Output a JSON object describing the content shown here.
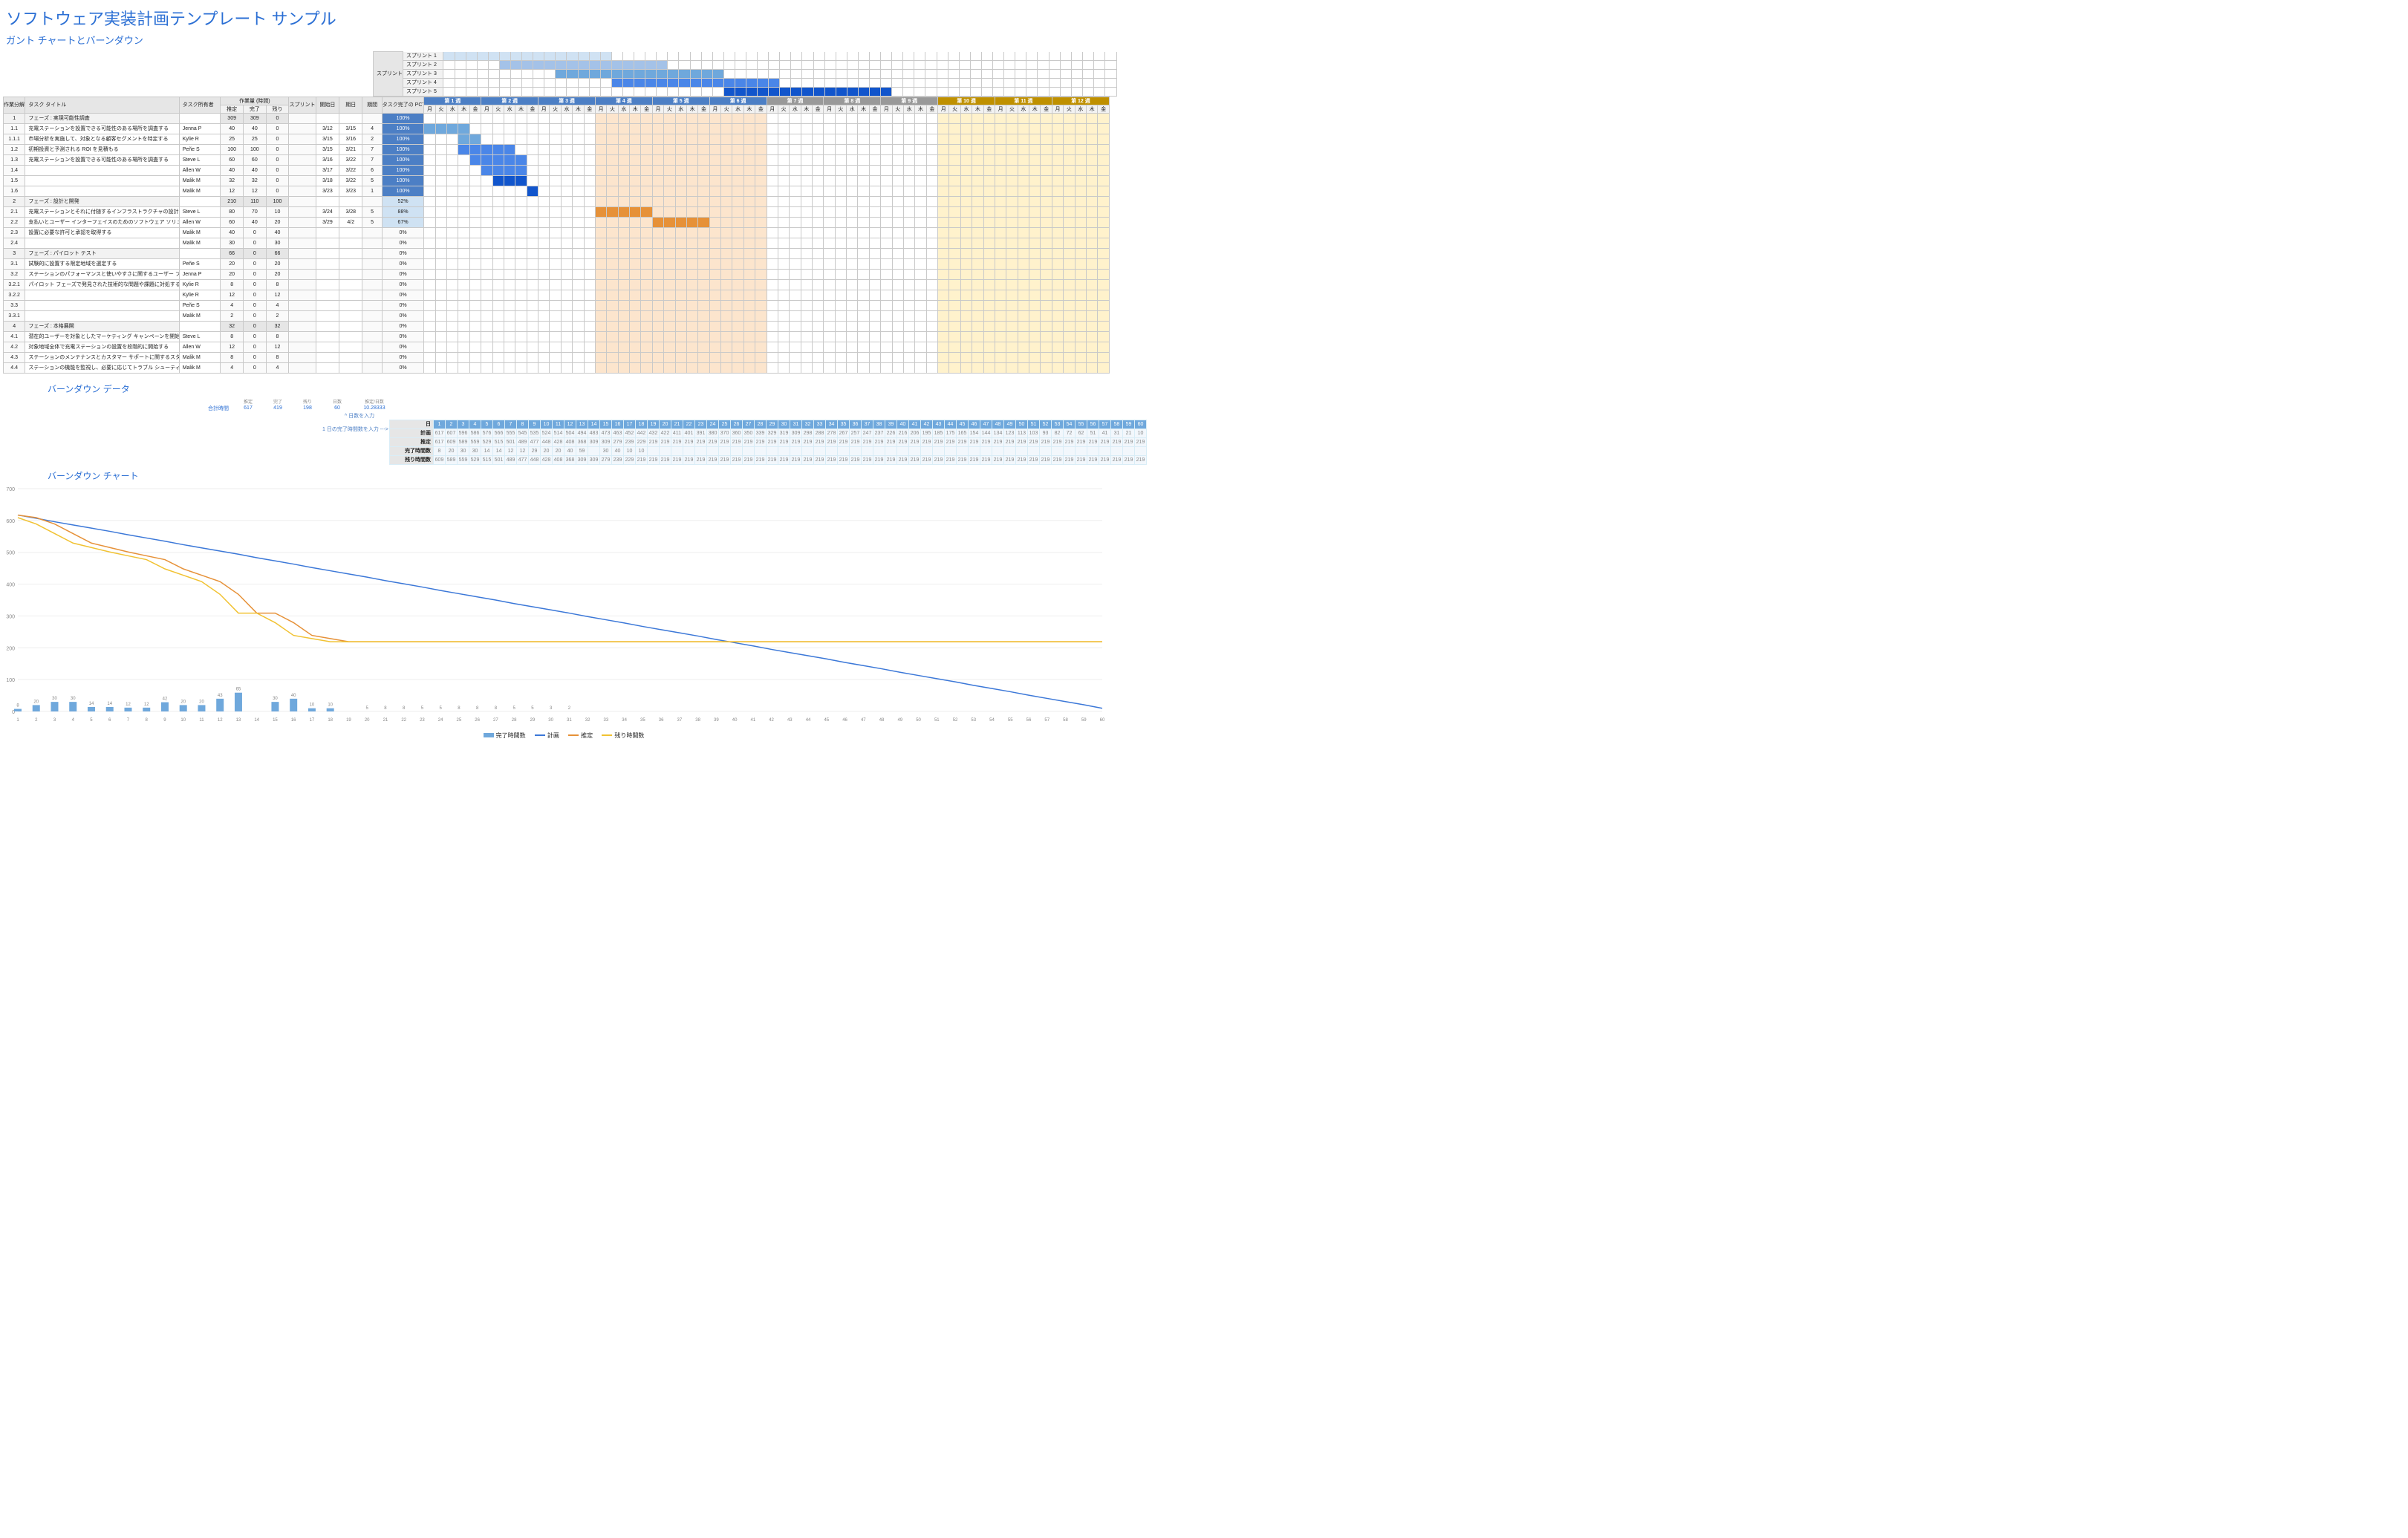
{
  "title": "ソフトウェア実装計画テンプレート サンプル",
  "subtitle": "ガント チャートとバーンダウン",
  "sprint_label": "スプリント",
  "sprints": [
    "スプリント 1",
    "スプリント 2",
    "スプリント 3",
    "スプリント 4",
    "スプリント 5"
  ],
  "cols": {
    "wbs": "作業分解構成",
    "title": "タスク タイトル",
    "owner": "タスク所有者",
    "workload": "作業量 (時間)",
    "est": "推定",
    "done": "完了",
    "rem": "残り",
    "sprint": "スプリント",
    "start": "開始日",
    "end": "期日",
    "dur": "期間",
    "pct": "タスク完了の PCT"
  },
  "weeks": [
    {
      "label": "第 1 週",
      "cls": "blueH"
    },
    {
      "label": "第 2 週",
      "cls": "blueH"
    },
    {
      "label": "第 3 週",
      "cls": "blueH"
    },
    {
      "label": "第 4 週",
      "cls": "blueH"
    },
    {
      "label": "第 5 週",
      "cls": "blueH"
    },
    {
      "label": "第 6 週",
      "cls": "blueH"
    },
    {
      "label": "第 7 週",
      "cls": "grayH"
    },
    {
      "label": "第 8 週",
      "cls": "grayH"
    },
    {
      "label": "第 9 週",
      "cls": "grayH"
    },
    {
      "label": "第 10 週",
      "cls": "goldH"
    },
    {
      "label": "第 11 週",
      "cls": "goldH"
    },
    {
      "label": "第 12 週",
      "cls": "goldH"
    }
  ],
  "days": [
    "月",
    "火",
    "水",
    "木",
    "金"
  ],
  "rows": [
    {
      "n": "1",
      "t": "フェーズ : 実現可能性調査",
      "o": "",
      "e": "309",
      "d": "309",
      "r": "0",
      "sp": "",
      "s": "",
      "en": "",
      "du": "",
      "p": "100%",
      "pc": "pct100",
      "phase": 1,
      "bar": null
    },
    {
      "n": "1.1",
      "t": "充電ステーションを設置できる可能性のある場所を調査する",
      "o": "Jenna P",
      "e": "40",
      "d": "40",
      "r": "0",
      "sp": "",
      "s": "3/12",
      "en": "3/15",
      "du": "4",
      "p": "100%",
      "pc": "pct100",
      "bar": [
        0,
        4,
        "bfill1"
      ]
    },
    {
      "n": "1.1.1",
      "t": "市場分析を実施して、対象となる顧客セグメントを特定する",
      "o": "Kylie R",
      "e": "25",
      "d": "25",
      "r": "0",
      "sp": "",
      "s": "3/15",
      "en": "3/16",
      "du": "2",
      "p": "100%",
      "pc": "pct100",
      "bar": [
        3,
        2,
        "bfill1"
      ]
    },
    {
      "n": "1.2",
      "t": "初期投資と予測される ROI を見積もる",
      "o": "Peñe S",
      "e": "100",
      "d": "100",
      "r": "0",
      "sp": "",
      "s": "3/15",
      "en": "3/21",
      "du": "7",
      "p": "100%",
      "pc": "pct100",
      "bar": [
        3,
        5,
        "bfill2"
      ]
    },
    {
      "n": "1.3",
      "t": "充電ステーションを設置できる可能性のある場所を調査する",
      "o": "Steve L",
      "e": "60",
      "d": "60",
      "r": "0",
      "sp": "",
      "s": "3/16",
      "en": "3/22",
      "du": "7",
      "p": "100%",
      "pc": "pct100",
      "bar": [
        4,
        5,
        "bfill2"
      ]
    },
    {
      "n": "1.4",
      "t": "",
      "o": "Allen W",
      "e": "40",
      "d": "40",
      "r": "0",
      "sp": "",
      "s": "3/17",
      "en": "3/22",
      "du": "6",
      "p": "100%",
      "pc": "pct100",
      "bar": [
        5,
        4,
        "bfill2"
      ]
    },
    {
      "n": "1.5",
      "t": "",
      "o": "Malik M",
      "e": "32",
      "d": "32",
      "r": "0",
      "sp": "",
      "s": "3/18",
      "en": "3/22",
      "du": "5",
      "p": "100%",
      "pc": "pct100",
      "bar": [
        6,
        3,
        "bfill3"
      ]
    },
    {
      "n": "1.6",
      "t": "",
      "o": "Malik M",
      "e": "12",
      "d": "12",
      "r": "0",
      "sp": "",
      "s": "3/23",
      "en": "3/23",
      "du": "1",
      "p": "100%",
      "pc": "pct100",
      "bar": [
        9,
        1,
        "bfill3"
      ]
    },
    {
      "n": "2",
      "t": "フェーズ : 設計と開発",
      "o": "",
      "e": "210",
      "d": "110",
      "r": "100",
      "sp": "",
      "s": "",
      "en": "",
      "du": "",
      "p": "52%",
      "pc": "pct",
      "phase": 1,
      "bar": null
    },
    {
      "n": "2.1",
      "t": "充電ステーションとそれに付随するインフラストラクチャの設計を確定する",
      "o": "Steve L",
      "e": "80",
      "d": "70",
      "r": "10",
      "sp": "",
      "s": "3/24",
      "en": "3/28",
      "du": "5",
      "p": "88%",
      "pc": "pct",
      "bar": [
        15,
        5,
        "of"
      ]
    },
    {
      "n": "2.2",
      "t": "支払いとユーザー インターフェイスのためのソフトウェア ソリューションを開発する",
      "o": "Allen W",
      "e": "60",
      "d": "40",
      "r": "20",
      "sp": "",
      "s": "3/29",
      "en": "4/2",
      "du": "5",
      "p": "67%",
      "pc": "pct",
      "bar": [
        20,
        5,
        "of"
      ]
    },
    {
      "n": "2.3",
      "t": "設置に必要な許可と承認を取得する",
      "o": "Malik M",
      "e": "40",
      "d": "0",
      "r": "40",
      "sp": "",
      "s": "",
      "en": "",
      "du": "",
      "p": "0%",
      "pc": "",
      "bar": null
    },
    {
      "n": "2.4",
      "t": "",
      "o": "Malik M",
      "e": "30",
      "d": "0",
      "r": "30",
      "sp": "",
      "s": "",
      "en": "",
      "du": "",
      "p": "0%",
      "pc": "",
      "bar": null
    },
    {
      "n": "3",
      "t": "フェーズ : パイロット テスト",
      "o": "",
      "e": "66",
      "d": "0",
      "r": "66",
      "sp": "",
      "s": "",
      "en": "",
      "du": "",
      "p": "0%",
      "pc": "",
      "phase": 1,
      "bar": null
    },
    {
      "n": "3.1",
      "t": "試験的に設置する限定地域を選定する",
      "o": "Peñe S",
      "e": "20",
      "d": "0",
      "r": "20",
      "sp": "",
      "s": "",
      "en": "",
      "du": "",
      "p": "0%",
      "pc": "",
      "bar": null
    },
    {
      "n": "3.2",
      "t": "ステーションのパフォーマンスと使いやすさに関するユーザー フィードバックを収集する",
      "o": "Jenna P",
      "e": "20",
      "d": "0",
      "r": "20",
      "sp": "",
      "s": "",
      "en": "",
      "du": "",
      "p": "0%",
      "pc": "",
      "bar": null
    },
    {
      "n": "3.2.1",
      "t": "パイロット フェーズで発見された技術的な問題や課題に対処する",
      "o": "Kylie R",
      "e": "8",
      "d": "0",
      "r": "8",
      "sp": "",
      "s": "",
      "en": "",
      "du": "",
      "p": "0%",
      "pc": "",
      "bar": null
    },
    {
      "n": "3.2.2",
      "t": "",
      "o": "Kylie R",
      "e": "12",
      "d": "0",
      "r": "12",
      "sp": "",
      "s": "",
      "en": "",
      "du": "",
      "p": "0%",
      "pc": "",
      "bar": null
    },
    {
      "n": "3.3",
      "t": "",
      "o": "Peñe S",
      "e": "4",
      "d": "0",
      "r": "4",
      "sp": "",
      "s": "",
      "en": "",
      "du": "",
      "p": "0%",
      "pc": "",
      "bar": null
    },
    {
      "n": "3.3.1",
      "t": "",
      "o": "Malik M",
      "e": "2",
      "d": "0",
      "r": "2",
      "sp": "",
      "s": "",
      "en": "",
      "du": "",
      "p": "0%",
      "pc": "",
      "bar": null
    },
    {
      "n": "4",
      "t": "フェーズ : 本格展開",
      "o": "",
      "e": "32",
      "d": "0",
      "r": "32",
      "sp": "",
      "s": "",
      "en": "",
      "du": "",
      "p": "0%",
      "pc": "",
      "phase": 1,
      "bar": null
    },
    {
      "n": "4.1",
      "t": "潜在的ユーザーを対象としたマーケティング キャンペーンを開始する",
      "o": "Steve L",
      "e": "8",
      "d": "0",
      "r": "8",
      "sp": "",
      "s": "",
      "en": "",
      "du": "",
      "p": "0%",
      "pc": "",
      "bar": null
    },
    {
      "n": "4.2",
      "t": "対象地域全体で充電ステーションの設置を段階的に開始する",
      "o": "Allen W",
      "e": "12",
      "d": "0",
      "r": "12",
      "sp": "",
      "s": "",
      "en": "",
      "du": "",
      "p": "0%",
      "pc": "",
      "bar": null
    },
    {
      "n": "4.3",
      "t": "ステーションのメンテナンスとカスタマー サポートに関するスタッフのトレーニングを行う",
      "o": "Malik M",
      "e": "8",
      "d": "0",
      "r": "8",
      "sp": "",
      "s": "",
      "en": "",
      "du": "",
      "p": "0%",
      "pc": "",
      "bar": null
    },
    {
      "n": "4.4",
      "t": "ステーションの機能を監視し、必要に応じてトラブル シューティングを行う",
      "o": "Malik M",
      "e": "4",
      "d": "0",
      "r": "4",
      "sp": "",
      "s": "",
      "en": "",
      "du": "",
      "p": "0%",
      "pc": "",
      "bar": null
    }
  ],
  "bd": {
    "title": "バーンダウン データ",
    "total_label": "合計時間",
    "est": "推定",
    "done": "完了",
    "rem": "残り",
    "days": "日数",
    "rate": "推定/日数",
    "total": "617",
    "d": "419",
    "r": "198",
    "dd": "60",
    "rr": "10.28333",
    "note1": "^ 日数を入力",
    "note2": "1 日の完了時間数を入力 --->",
    "rows": {
      "day": "日",
      "plan": "計画",
      "est": "推定",
      "done": "完了時間数",
      "rem": "残り時間数"
    }
  },
  "bd_data": {
    "plan": [
      "617",
      "607",
      "596",
      "586",
      "576",
      "566",
      "555",
      "545",
      "535",
      "524",
      "514",
      "504",
      "494",
      "483",
      "473",
      "463",
      "452",
      "442",
      "432",
      "422",
      "411",
      "401",
      "391",
      "380",
      "370",
      "360",
      "350",
      "339",
      "329",
      "319",
      "309",
      "298",
      "288",
      "278",
      "267",
      "257",
      "247",
      "237",
      "226",
      "216",
      "206",
      "195",
      "185",
      "175",
      "165",
      "154",
      "144",
      "134",
      "123",
      "113",
      "103",
      "93",
      "82",
      "72",
      "62",
      "51",
      "41",
      "31",
      "21",
      "10"
    ],
    "est": [
      "617",
      "609",
      "589",
      "559",
      "529",
      "515",
      "501",
      "489",
      "477",
      "448",
      "428",
      "408",
      "368",
      "309",
      "309",
      "279",
      "239",
      "229",
      "219",
      "219",
      "219",
      "219",
      "219",
      "219",
      "219",
      "219",
      "219",
      "219",
      "219",
      "219",
      "219",
      "219",
      "219",
      "219",
      "219",
      "219",
      "219",
      "219",
      "219",
      "219",
      "219",
      "219",
      "219",
      "219",
      "219",
      "219",
      "219",
      "219",
      "219",
      "219",
      "219",
      "219",
      "219",
      "219",
      "219",
      "219",
      "219",
      "219",
      "219",
      "219"
    ],
    "done": [
      "8",
      "20",
      "30",
      "30",
      "14",
      "14",
      "12",
      "12",
      "29",
      "20",
      "20",
      "40",
      "59",
      "",
      "30",
      "40",
      "10",
      "10",
      "",
      "",
      "",
      "",
      "",
      "",
      "",
      "",
      "",
      "",
      "",
      "",
      "",
      "",
      "",
      "",
      "",
      "",
      "",
      "",
      "",
      "",
      "",
      "",
      "",
      "",
      "",
      "",
      "",
      "",
      "",
      "",
      "",
      "",
      "",
      "",
      "",
      "",
      "",
      "",
      "",
      ""
    ],
    "rem": [
      "609",
      "589",
      "559",
      "529",
      "515",
      "501",
      "489",
      "477",
      "448",
      "428",
      "408",
      "368",
      "309",
      "309",
      "279",
      "239",
      "229",
      "219",
      "219",
      "219",
      "219",
      "219",
      "219",
      "219",
      "219",
      "219",
      "219",
      "219",
      "219",
      "219",
      "219",
      "219",
      "219",
      "219",
      "219",
      "219",
      "219",
      "219",
      "219",
      "219",
      "219",
      "219",
      "219",
      "219",
      "219",
      "219",
      "219",
      "219",
      "219",
      "219",
      "219",
      "219",
      "219",
      "219",
      "219",
      "219",
      "219",
      "219",
      "219",
      "219"
    ]
  },
  "chart": {
    "title": "バーンダウン チャート",
    "legend": [
      "完了時間数",
      "計画",
      "推定",
      "残り時間数"
    ],
    "ymax": 700
  },
  "chart_data": {
    "type": "line",
    "x": [
      1,
      2,
      3,
      4,
      5,
      6,
      7,
      8,
      9,
      10,
      11,
      12,
      13,
      14,
      15,
      16,
      17,
      18,
      19,
      20,
      21,
      22,
      23,
      24,
      25,
      26,
      27,
      28,
      29,
      30,
      31,
      32,
      33,
      34,
      35,
      36,
      37,
      38,
      39,
      40,
      41,
      42,
      43,
      44,
      45,
      46,
      47,
      48,
      49,
      50,
      51,
      52,
      53,
      54,
      55,
      56,
      57,
      58,
      59,
      60
    ],
    "series": [
      {
        "name": "完了時間数",
        "type": "bar",
        "values": [
          8,
          20,
          30,
          30,
          14,
          14,
          12,
          12,
          29,
          20,
          20,
          40,
          59,
          0,
          30,
          40,
          10,
          10,
          0,
          0,
          0,
          0,
          0,
          0,
          0,
          0,
          0,
          0,
          0,
          0,
          0,
          0,
          0,
          0,
          0,
          0,
          0,
          0,
          0,
          0,
          0,
          0,
          0,
          0,
          0,
          0,
          0,
          0,
          0,
          0,
          0,
          0,
          0,
          0,
          0,
          0,
          0,
          0,
          0,
          0
        ],
        "labels": [
          "8",
          "20",
          "30",
          "30",
          "14",
          "14",
          "12",
          "12",
          "42",
          "20",
          "20",
          "43",
          "65",
          "",
          "30",
          "40",
          "10",
          "10",
          "",
          "5",
          "8",
          "8",
          "5",
          "5",
          "8",
          "8",
          "8",
          "5",
          "5",
          "3",
          "2",
          "",
          "",
          "",
          "",
          "",
          "",
          "",
          "",
          "",
          "",
          "",
          "",
          "",
          "",
          "",
          "",
          "",
          "",
          "",
          "",
          "",
          "",
          "",
          "",
          "",
          "",
          "",
          "",
          ""
        ]
      },
      {
        "name": "計画",
        "type": "line",
        "values": [
          617,
          607,
          596,
          586,
          576,
          566,
          555,
          545,
          535,
          524,
          514,
          504,
          494,
          483,
          473,
          463,
          452,
          442,
          432,
          422,
          411,
          401,
          391,
          380,
          370,
          360,
          350,
          339,
          329,
          319,
          309,
          298,
          288,
          278,
          267,
          257,
          247,
          237,
          226,
          216,
          206,
          195,
          185,
          175,
          165,
          154,
          144,
          134,
          123,
          113,
          103,
          93,
          82,
          72,
          62,
          51,
          41,
          31,
          21,
          10
        ]
      },
      {
        "name": "推定",
        "type": "line",
        "values": [
          617,
          609,
          589,
          559,
          529,
          515,
          501,
          489,
          477,
          448,
          428,
          408,
          368,
          309,
          309,
          279,
          239,
          229,
          219,
          219,
          219,
          219,
          219,
          219,
          219,
          219,
          219,
          219,
          219,
          219,
          219,
          219,
          219,
          219,
          219,
          219,
          219,
          219,
          219,
          219,
          219,
          219,
          219,
          219,
          219,
          219,
          219,
          219,
          219,
          219,
          219,
          219,
          219,
          219,
          219,
          219,
          219,
          219,
          219,
          219
        ]
      },
      {
        "name": "残り時間数",
        "type": "line",
        "values": [
          609,
          589,
          559,
          529,
          515,
          501,
          489,
          477,
          448,
          428,
          408,
          368,
          309,
          309,
          279,
          239,
          229,
          219,
          219,
          219,
          219,
          219,
          219,
          219,
          219,
          219,
          219,
          219,
          219,
          219,
          219,
          219,
          219,
          219,
          219,
          219,
          219,
          219,
          219,
          219,
          219,
          219,
          219,
          219,
          219,
          219,
          219,
          219,
          219,
          219,
          219,
          219,
          219,
          219,
          219,
          219,
          219,
          219,
          219,
          219
        ]
      }
    ],
    "title": "バーンダウン チャート",
    "xlabel": "",
    "ylabel": "",
    "ylim": [
      0,
      700
    ]
  }
}
